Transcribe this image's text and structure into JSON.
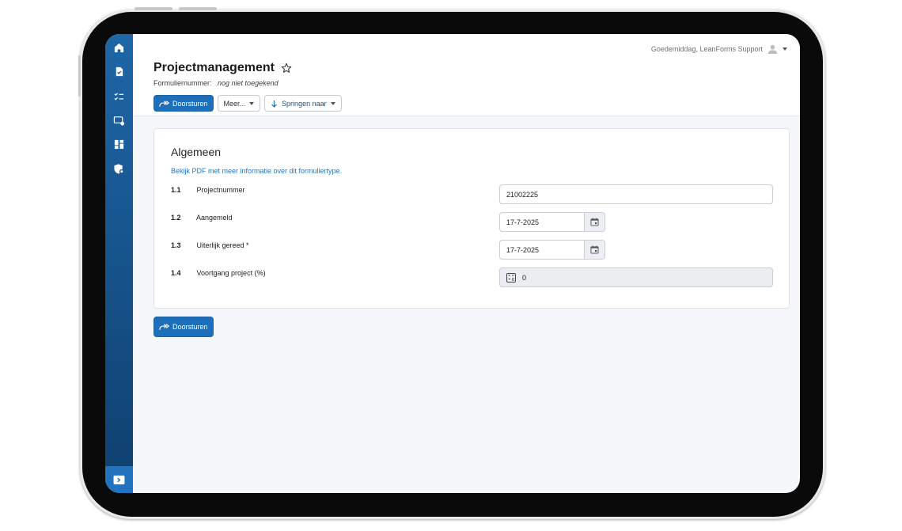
{
  "header": {
    "greeting": "Goedemiddag, LeanForms Support",
    "title": "Projectmanagement",
    "form_number_label": "Formuliernummer:",
    "form_number_value": "nog niet toegekend"
  },
  "toolbar": {
    "forward_label": "Doorsturen",
    "more_label": "Meer...",
    "jump_label": "Springen naar"
  },
  "section": {
    "title": "Algemeen",
    "pdf_link": "Bekijk PDF met meer informatie over dit formuliertype."
  },
  "fields": [
    {
      "num": "1.1",
      "label": "Projectnummer",
      "value": "21002225"
    },
    {
      "num": "1.2",
      "label": "Aangemeld",
      "value": "17-7-2025"
    },
    {
      "num": "1.3",
      "label": "Uiterlijk gereed *",
      "value": "17-7-2025"
    },
    {
      "num": "1.4",
      "label": "Voortgang project (%)",
      "value": "0"
    }
  ],
  "footer": {
    "forward_label": "Doorsturen"
  },
  "sidebar": {
    "icons": [
      "home-icon",
      "document-icon",
      "checklist-icon",
      "screen-settings-icon",
      "dashboard-icon",
      "shield-settings-icon"
    ],
    "bottom_icon": "expand-icon"
  },
  "colors": {
    "accent": "#1d6fb9",
    "sidebar": "#17558e",
    "link": "#2b78bd"
  }
}
